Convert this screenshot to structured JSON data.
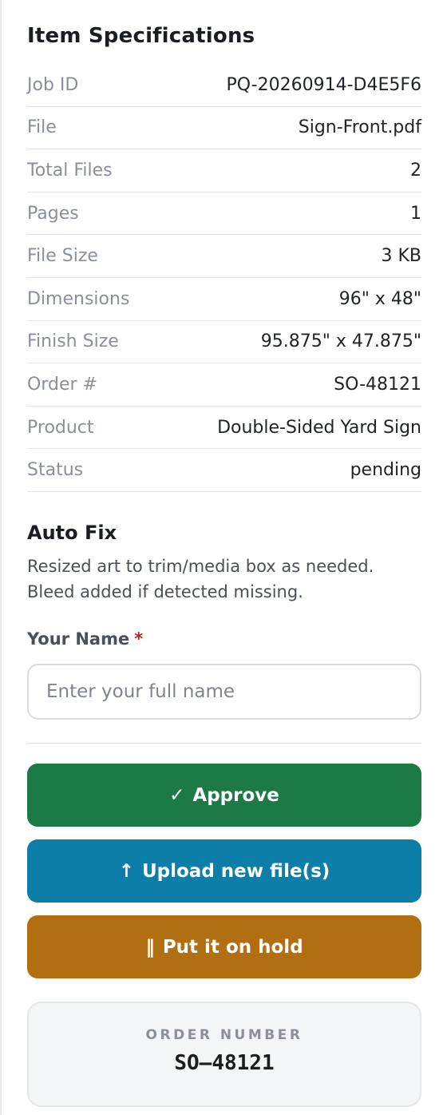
{
  "specifications": {
    "title": "Item Specifications",
    "rows": [
      {
        "label": "Job ID",
        "value": "PQ-20260914-D4E5F6"
      },
      {
        "label": "File",
        "value": "Sign-Front.pdf"
      },
      {
        "label": "Total Files",
        "value": "2"
      },
      {
        "label": "Pages",
        "value": "1"
      },
      {
        "label": "File Size",
        "value": "3 KB"
      },
      {
        "label": "Dimensions",
        "value": "96\" x 48\""
      },
      {
        "label": "Finish Size",
        "value": "95.875\" x 47.875\""
      },
      {
        "label": "Order #",
        "value": "SO-48121"
      },
      {
        "label": "Product",
        "value": "Double-Sided Yard Sign"
      },
      {
        "label": "Status",
        "value": "pending"
      }
    ]
  },
  "auto_fix": {
    "title": "Auto Fix",
    "line1": "Resized art to trim/media box as needed.",
    "line2": "Bleed added if detected missing."
  },
  "name_field": {
    "label": "Your Name",
    "required_marker": "*",
    "placeholder": "Enter your full name",
    "value": ""
  },
  "actions": {
    "approve": {
      "icon": "✓",
      "icon_name": "checkmark-icon",
      "label": "Approve",
      "color": "#1b7a46"
    },
    "upload": {
      "icon": "↑",
      "icon_name": "upload-arrow-icon",
      "label": "Upload new file(s)",
      "color": "#0d7ea8"
    },
    "hold": {
      "icon": "‖",
      "icon_name": "pause-icon",
      "label": "Put it on hold",
      "color": "#b26f12"
    }
  },
  "order_card": {
    "caption": "ORDER NUMBER",
    "value": "SO–48121"
  }
}
